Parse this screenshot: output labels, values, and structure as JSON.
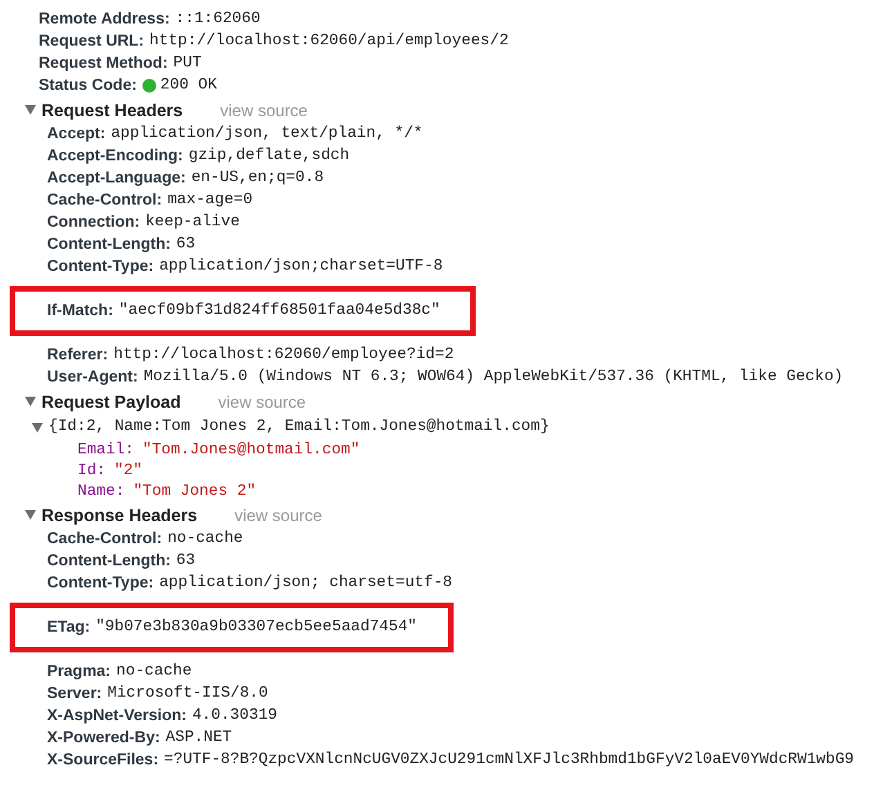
{
  "general": [
    {
      "name": "Remote Address:",
      "value": "::1:62060"
    },
    {
      "name": "Request URL:",
      "value": "http://localhost:62060/api/employees/2"
    },
    {
      "name": "Request Method:",
      "value": "PUT"
    },
    {
      "name": "Status Code:",
      "value": "200 OK",
      "color": "#2fb32f"
    }
  ],
  "sections": [
    {
      "kind": "headers",
      "title": "Request Headers",
      "link": "view source",
      "expanded": true,
      "headers": [
        {
          "name": "Accept:",
          "value": "application/json, text/plain, */*",
          "highlighted": false
        },
        {
          "name": "Accept-Encoding:",
          "value": "gzip,deflate,sdch",
          "highlighted": false
        },
        {
          "name": "Accept-Language:",
          "value": "en-US,en;q=0.8",
          "highlighted": false
        },
        {
          "name": "Cache-Control:",
          "value": "max-age=0",
          "highlighted": false
        },
        {
          "name": "Connection:",
          "value": "keep-alive",
          "highlighted": false
        },
        {
          "name": "Content-Length:",
          "value": "63",
          "highlighted": false
        },
        {
          "name": "Content-Type:",
          "value": "application/json;charset=UTF-8",
          "highlighted": false
        },
        {
          "name": "If-Match:",
          "value": "\"aecf09bf31d824ff68501faa04e5d38c\"",
          "highlighted": true
        },
        {
          "name": "Referer:",
          "value": "http://localhost:62060/employee?id=2",
          "highlighted": false
        },
        {
          "name": "User-Agent:",
          "value": "Mozilla/5.0 (Windows NT 6.3; WOW64) AppleWebKit/537.36 (KHTML, like Gecko)",
          "highlighted": false
        }
      ]
    },
    {
      "kind": "payload",
      "title": "Request Payload",
      "link": "view source",
      "expanded": true,
      "object": {
        "summary": "{Id:2, Name:Tom Jones 2, Email:Tom.Jones@hotmail.com}",
        "expanded": true,
        "properties": [
          {
            "name": "Email:",
            "value": "\"Tom.Jones@hotmail.com\""
          },
          {
            "name": "Id:",
            "value": "\"2\""
          },
          {
            "name": "Name:",
            "value": "\"Tom Jones 2\""
          }
        ]
      }
    },
    {
      "kind": "headers",
      "title": "Response Headers",
      "link": "view source",
      "expanded": true,
      "headers": [
        {
          "name": "Cache-Control:",
          "value": "no-cache",
          "highlighted": false
        },
        {
          "name": "Content-Length:",
          "value": "63",
          "highlighted": false
        },
        {
          "name": "Content-Type:",
          "value": "application/json; charset=utf-8",
          "highlighted": false
        },
        {
          "name": "ETag:",
          "value": "\"9b07e3b830a9b03307ecb5ee5aad7454\"",
          "highlighted": true
        },
        {
          "name": "Pragma:",
          "value": "no-cache",
          "highlighted": false
        },
        {
          "name": "Server:",
          "value": "Microsoft-IIS/8.0",
          "highlighted": false
        },
        {
          "name": "X-AspNet-Version:",
          "value": "4.0.30319",
          "highlighted": false
        },
        {
          "name": "X-Powered-By:",
          "value": "ASP.NET",
          "highlighted": false
        },
        {
          "name": "X-SourceFiles:",
          "value": "=?UTF-8?B?QzpcVXNlcnNcUGV0ZXJcU291cmNlXFJlc3Rhbmd1bGFyV2l0aEV0YWdcRW1wbG9",
          "highlighted": false
        }
      ]
    }
  ]
}
